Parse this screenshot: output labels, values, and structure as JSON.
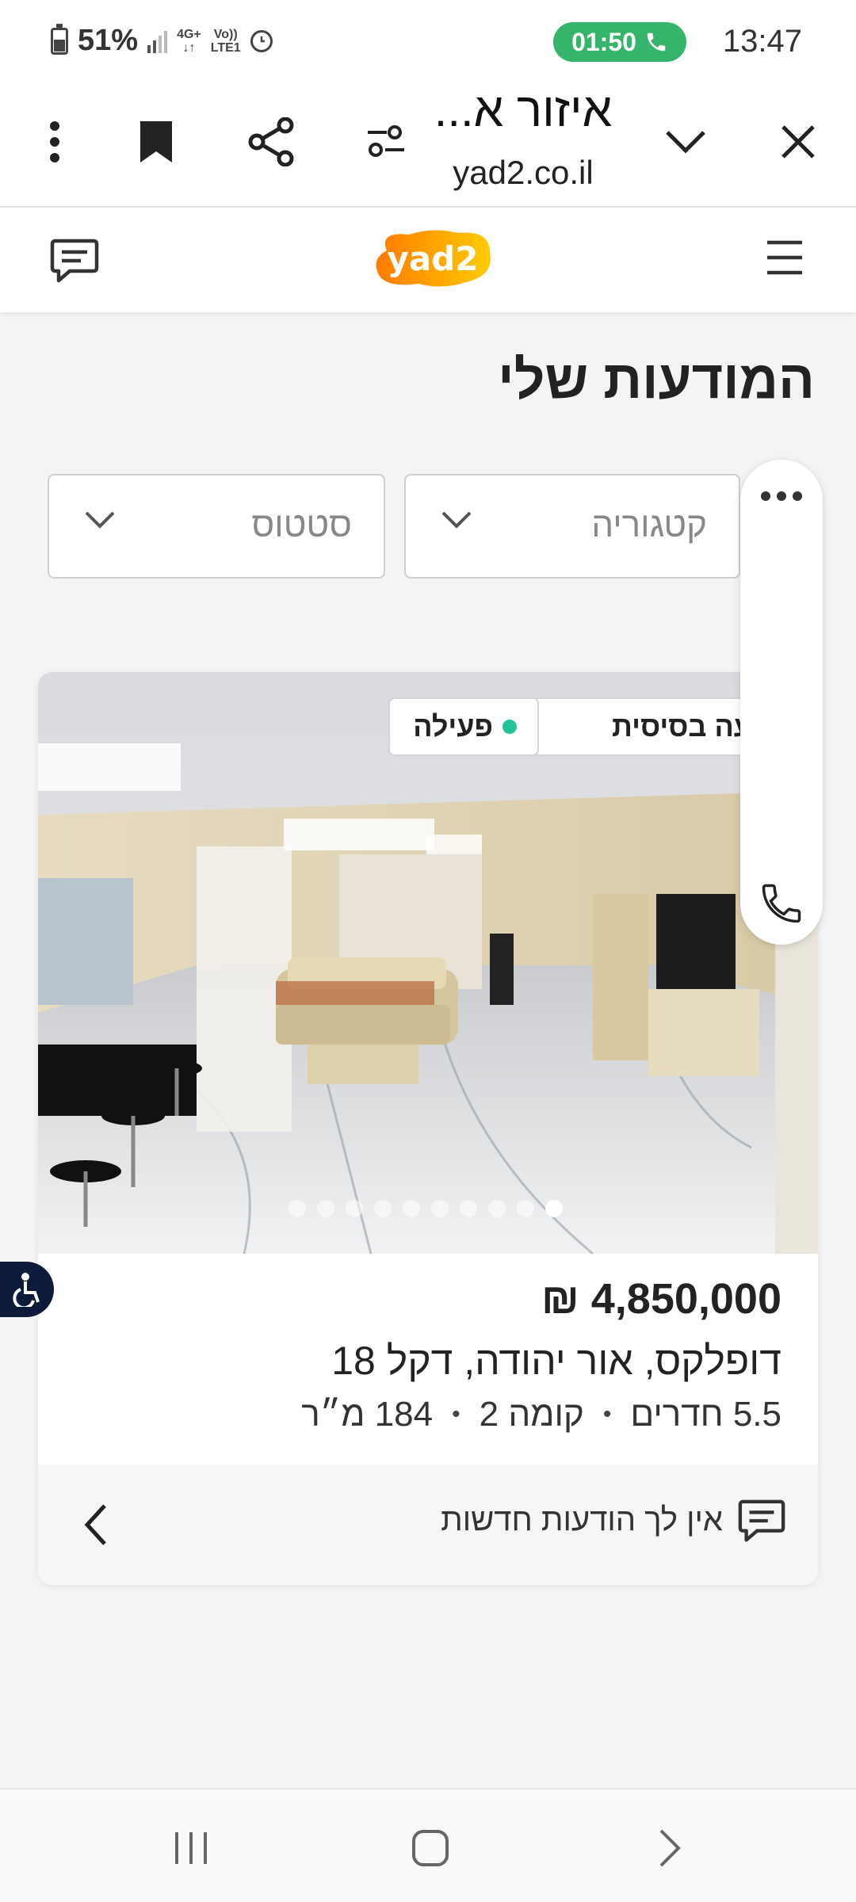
{
  "status_bar": {
    "battery": "51%",
    "battery_level": 0.51,
    "network_top": "4G+",
    "network_bottom": "",
    "volte_top": "Vo))",
    "volte_bottom": "LTE1",
    "call_timer": "01:50",
    "time": "13:47",
    "call_color": "#35b46b"
  },
  "browser": {
    "title": "איזור א...",
    "url": "yad2.co.il"
  },
  "site": {
    "logo_text": "yad2",
    "logo_colors": [
      "#ff7a00",
      "#ffcc00"
    ],
    "page_title": "המודעות שלי"
  },
  "filters": {
    "category_placeholder": "קטגוריה",
    "status_placeholder": "סטטוס"
  },
  "listing": {
    "badge_type": "מודעה בסיסית",
    "badge_status": "פעילה",
    "status_color": "#21c39a",
    "image_count": 10,
    "active_image_index": 0,
    "price": "4,850,000 ₪",
    "address": "דופלקס, אור יהודה, דקל 18",
    "rooms": "5.5 חדרים",
    "floor": "קומה 2",
    "size": "184 מ״ר",
    "separator": "•",
    "messages_text": "אין לך הודעות חדשות"
  }
}
